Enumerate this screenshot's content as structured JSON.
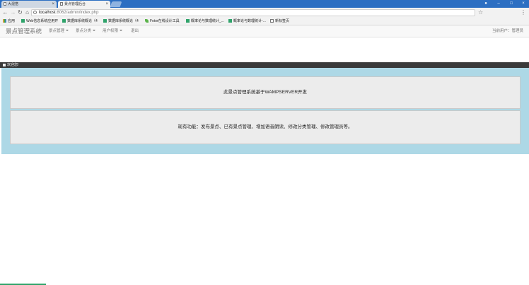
{
  "browser": {
    "tabs": [
      {
        "title": "大混搭",
        "active": false
      },
      {
        "title": "景点管理后台",
        "active": true
      }
    ],
    "address": {
      "host": "localhost",
      "path": ":8062/admin/index.php"
    },
    "bookmarks": [
      {
        "label": "应用",
        "icon": "apps-grid-icon"
      },
      {
        "label": "Web信息系统应用开",
        "icon": "bookmark-leaf-icon"
      },
      {
        "label": "数据库系统概论（4",
        "icon": "bookmark-leaf-icon"
      },
      {
        "label": "数据库系统概论（4",
        "icon": "bookmark-leaf-icon"
      },
      {
        "label": "Fotor在线设计工具",
        "icon": "fotor-icon"
      },
      {
        "label": "概率论与数理统计_...",
        "icon": "bookmark-leaf-icon"
      },
      {
        "label": "概率论与数理统计-...",
        "icon": "bookmark-leaf-icon"
      },
      {
        "label": "新标签页",
        "icon": "page-icon"
      }
    ]
  },
  "navbar": {
    "brand": "景点管理系统",
    "items": [
      {
        "label": "景点管理",
        "dropdown": true
      },
      {
        "label": "景点分类",
        "dropdown": true
      },
      {
        "label": "用户权限",
        "dropdown": true
      },
      {
        "label": "退出",
        "dropdown": false
      }
    ],
    "current_user": "当前用户：管理员"
  },
  "breadcrumb": {
    "label": "欢迎您!"
  },
  "content": {
    "line1": "此景点管理系统基于WAMPSERVER开发",
    "line2": "现有功能：发布景点、已有景点管理、增加语音朗读、修改分类管理、修改管理员等。"
  },
  "colors": {
    "titlebar": "#2d6fc2",
    "panel": "#add8e6",
    "well": "#ececec",
    "breadcrumb": "#3a3a3a"
  }
}
